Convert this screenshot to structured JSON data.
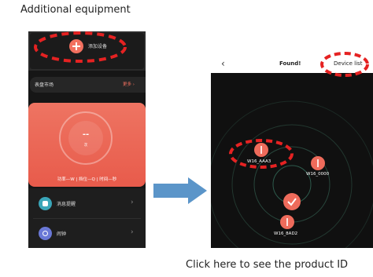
{
  "captions": {
    "top": "Additional equipment",
    "bottom": "Click here to see the product ID"
  },
  "left_screen": {
    "add_device": "添加设备",
    "market": {
      "label": "表盘市场",
      "more": "更多"
    },
    "card": {
      "value": "--",
      "unit": "次",
      "stats": "功率—W | 挡位—Q | 时间—秒"
    },
    "list": [
      {
        "label": "消息提醒",
        "icon": "message-icon"
      },
      {
        "label": "闹钟",
        "icon": "alarm-clock-icon"
      }
    ]
  },
  "right_screen": {
    "title": "Found!",
    "device_list": "Device list",
    "devices": [
      {
        "name": "W16_AAA3"
      },
      {
        "name": "W16_0000"
      },
      {
        "name": "W16_8AD2"
      }
    ]
  },
  "colors": {
    "accent": "#ee6b5b",
    "annotation": "#e52222",
    "arrow": "#5b95c9",
    "radar_ring": "#2d5a4c"
  }
}
